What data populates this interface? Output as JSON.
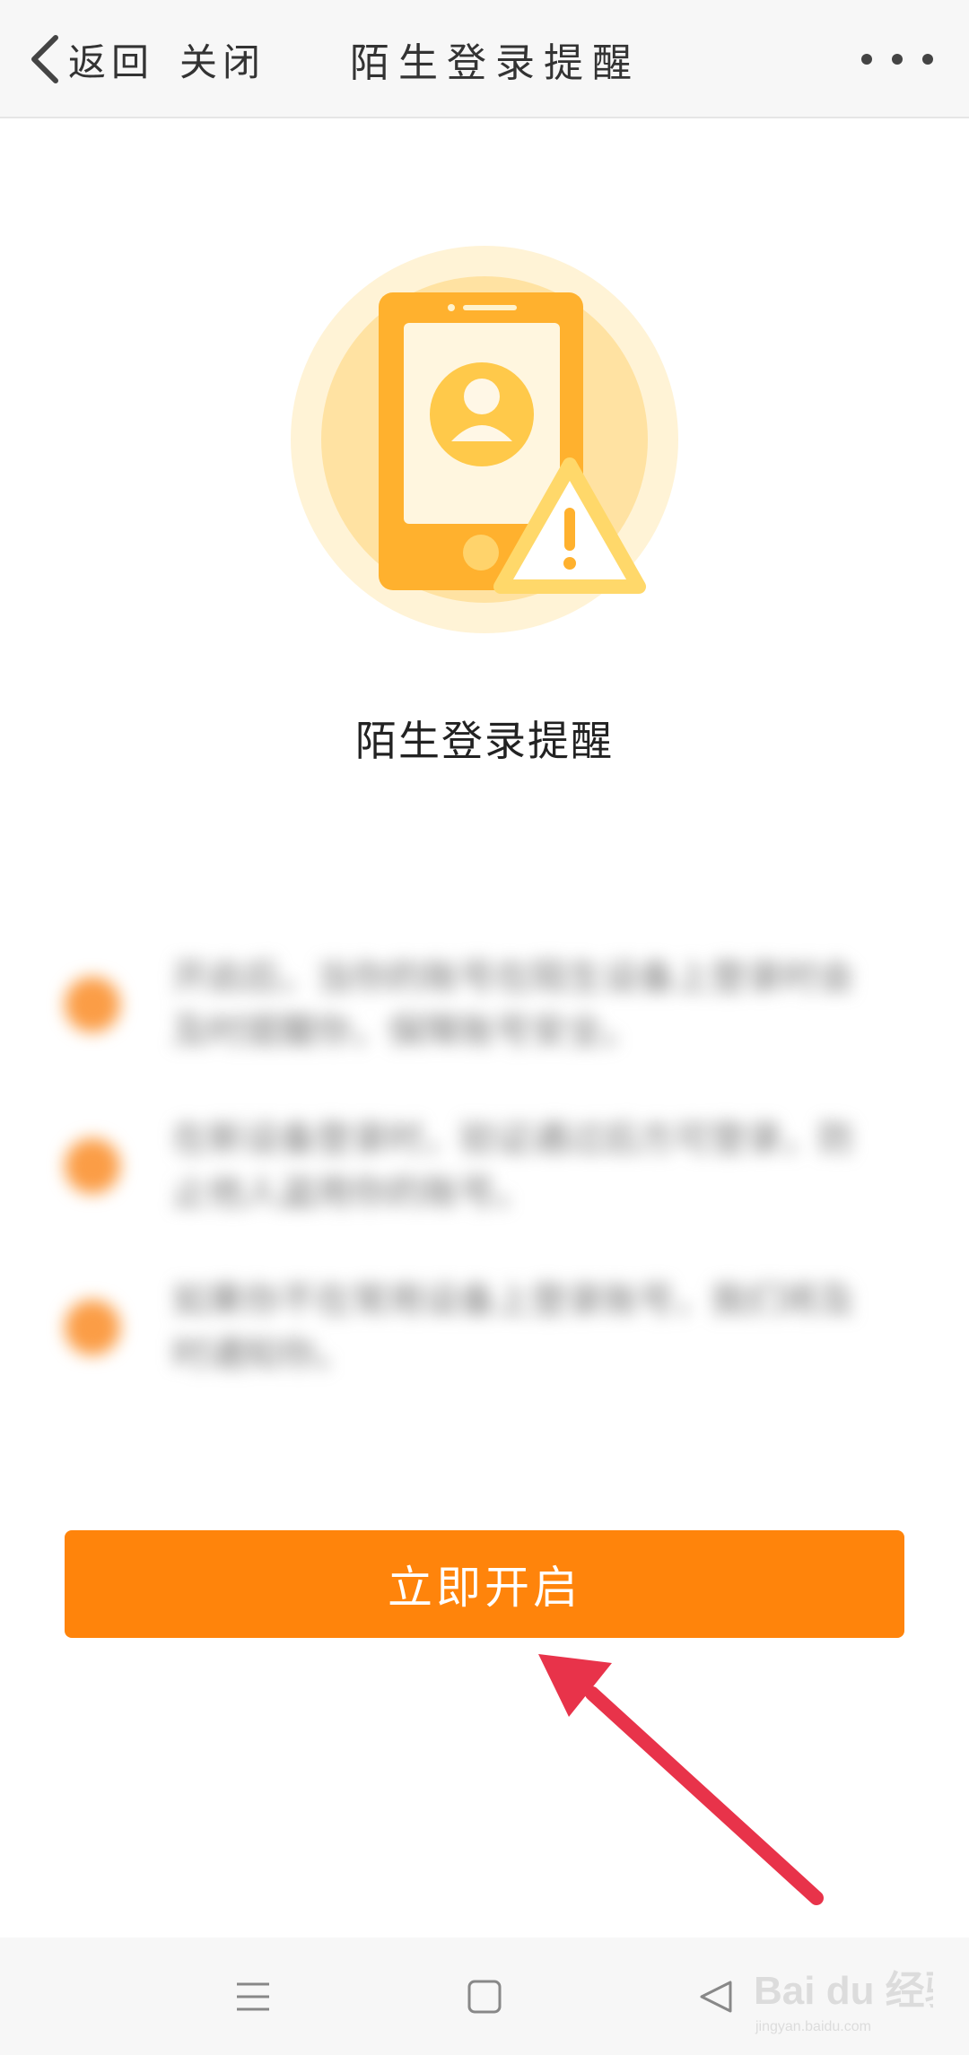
{
  "header": {
    "back_label": "返回",
    "close_label": "关闭",
    "title": "陌生登录提醒",
    "more_icon": "more-horizontal-icon"
  },
  "hero": {
    "icon": "phone-warning-icon"
  },
  "main": {
    "heading": "陌生登录提醒",
    "benefits": [
      {
        "text": "开启后，当你的账号在陌生设备上登录时会及时提醒你，保障账号安全。"
      },
      {
        "text": "在新设备登录时，验证通过后方可登录，防止他人盗用你的账号。"
      },
      {
        "text": "如果你不在常用设备上登录账号，我们将及时通知你。"
      }
    ],
    "cta_label": "立即开启"
  },
  "navbar": {
    "menu_icon": "menu-icon",
    "home_icon": "home-square-icon",
    "back_icon": "back-triangle-icon"
  },
  "watermark": {
    "brand": "Bai du 经验",
    "url": "jingyan.baidu.com"
  },
  "colors": {
    "accent": "#ff840b",
    "annotation_arrow": "#e8334a",
    "dot": "#fb9d46"
  }
}
